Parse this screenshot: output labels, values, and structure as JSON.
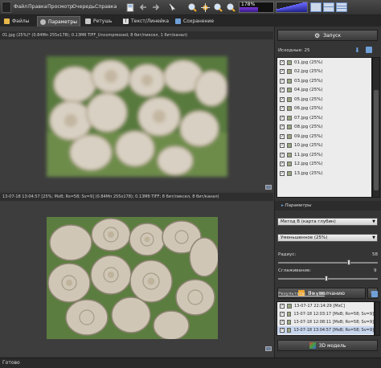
{
  "menu": [
    "Файл",
    "Правка",
    "Просмотр",
    "Очередь",
    "Справка"
  ],
  "toolbar": {
    "icons": [
      "save-icon",
      "back-arrow-icon",
      "forward-arrow-icon",
      "selection-tool-icon",
      "zoom-in-icon",
      "pan-icon",
      "zoom-fit-icon",
      "zoom-out-icon"
    ],
    "zoom_label": "178%",
    "zoom_level_fraction": 0.55,
    "level_bars": [
      4,
      5,
      6,
      7,
      8,
      9,
      10,
      11,
      12,
      12
    ],
    "view_buttons": [
      "single-view-icon",
      "split-horizontal-view-icon",
      "split-vertical-view-icon"
    ]
  },
  "tabs": [
    {
      "label": "Файлы",
      "icon": "folder-icon",
      "active": false
    },
    {
      "label": "Параметры",
      "icon": "gear-icon",
      "active": true
    },
    {
      "label": "Ретушь",
      "icon": "retouch-icon",
      "active": false
    },
    {
      "label": "Текст/Линейка",
      "icon": "text-icon",
      "active": false
    },
    {
      "label": "Сохранение",
      "icon": "save-icon",
      "active": false
    }
  ],
  "top_pane": {
    "info": "01.jpg (25%)* (0.84Mп 255x178); 0.13Мб TIFF_Uncompressed; 8 бит/пиксел, 1 бит/канал)"
  },
  "bottom_pane": {
    "info": "13-07-18 13:04:57 [25%; МхВ; Rs=58; Sv=9] (0.84Mп 255x178); 0.13Мб TIFF; 8 бит/пиксел, 8 бит/канал)"
  },
  "right_panel": {
    "run_button": "Запуск",
    "sources_label": "Исходные: 25",
    "files": [
      "01.jpg (25%)",
      "02.jpg (25%)",
      "03.jpg (25%)",
      "04.jpg (25%)",
      "05.jpg (25%)",
      "06.jpg (25%)",
      "07.jpg (25%)",
      "08.jpg (25%)",
      "09.jpg (25%)",
      "10.jpg (25%)",
      "11.jpg (25%)",
      "12.jpg (25%)",
      "13.jpg (25%)"
    ],
    "params_header": "Параметры",
    "method_select": "Метод B (карта глубин)",
    "reduce_select": "Уменьшенное (25%)",
    "radius_label": "Радиус:",
    "radius_value": "58",
    "radius_fraction": 0.72,
    "smoothing_label": "Сглаживание:",
    "smoothing_value": "9",
    "smoothing_fraction": 0.48,
    "default_button": "По умолчанию",
    "results_label": "Результаты: 9 из 20",
    "results": [
      {
        "text": "13-07-17 22:14:29 [МхС]",
        "selected": false
      },
      {
        "text": "13-07-18 12:03:17 [МхВ; Rs=58; Sv=9]",
        "selected": false
      },
      {
        "text": "13-07-18 12:08:11 [МхВ; Rs=58; Sv=9]",
        "selected": false
      },
      {
        "text": "13-07-18 13:04:57 [МхВ; Rs=58; Sv=9]",
        "selected": true
      }
    ],
    "model_button": "3D модель"
  },
  "status": "Готово",
  "colors": {
    "background": "#3a3a3a",
    "panel": "#353535",
    "accent_purple": "#7a3ad6",
    "selection": "#c8d6ee"
  }
}
